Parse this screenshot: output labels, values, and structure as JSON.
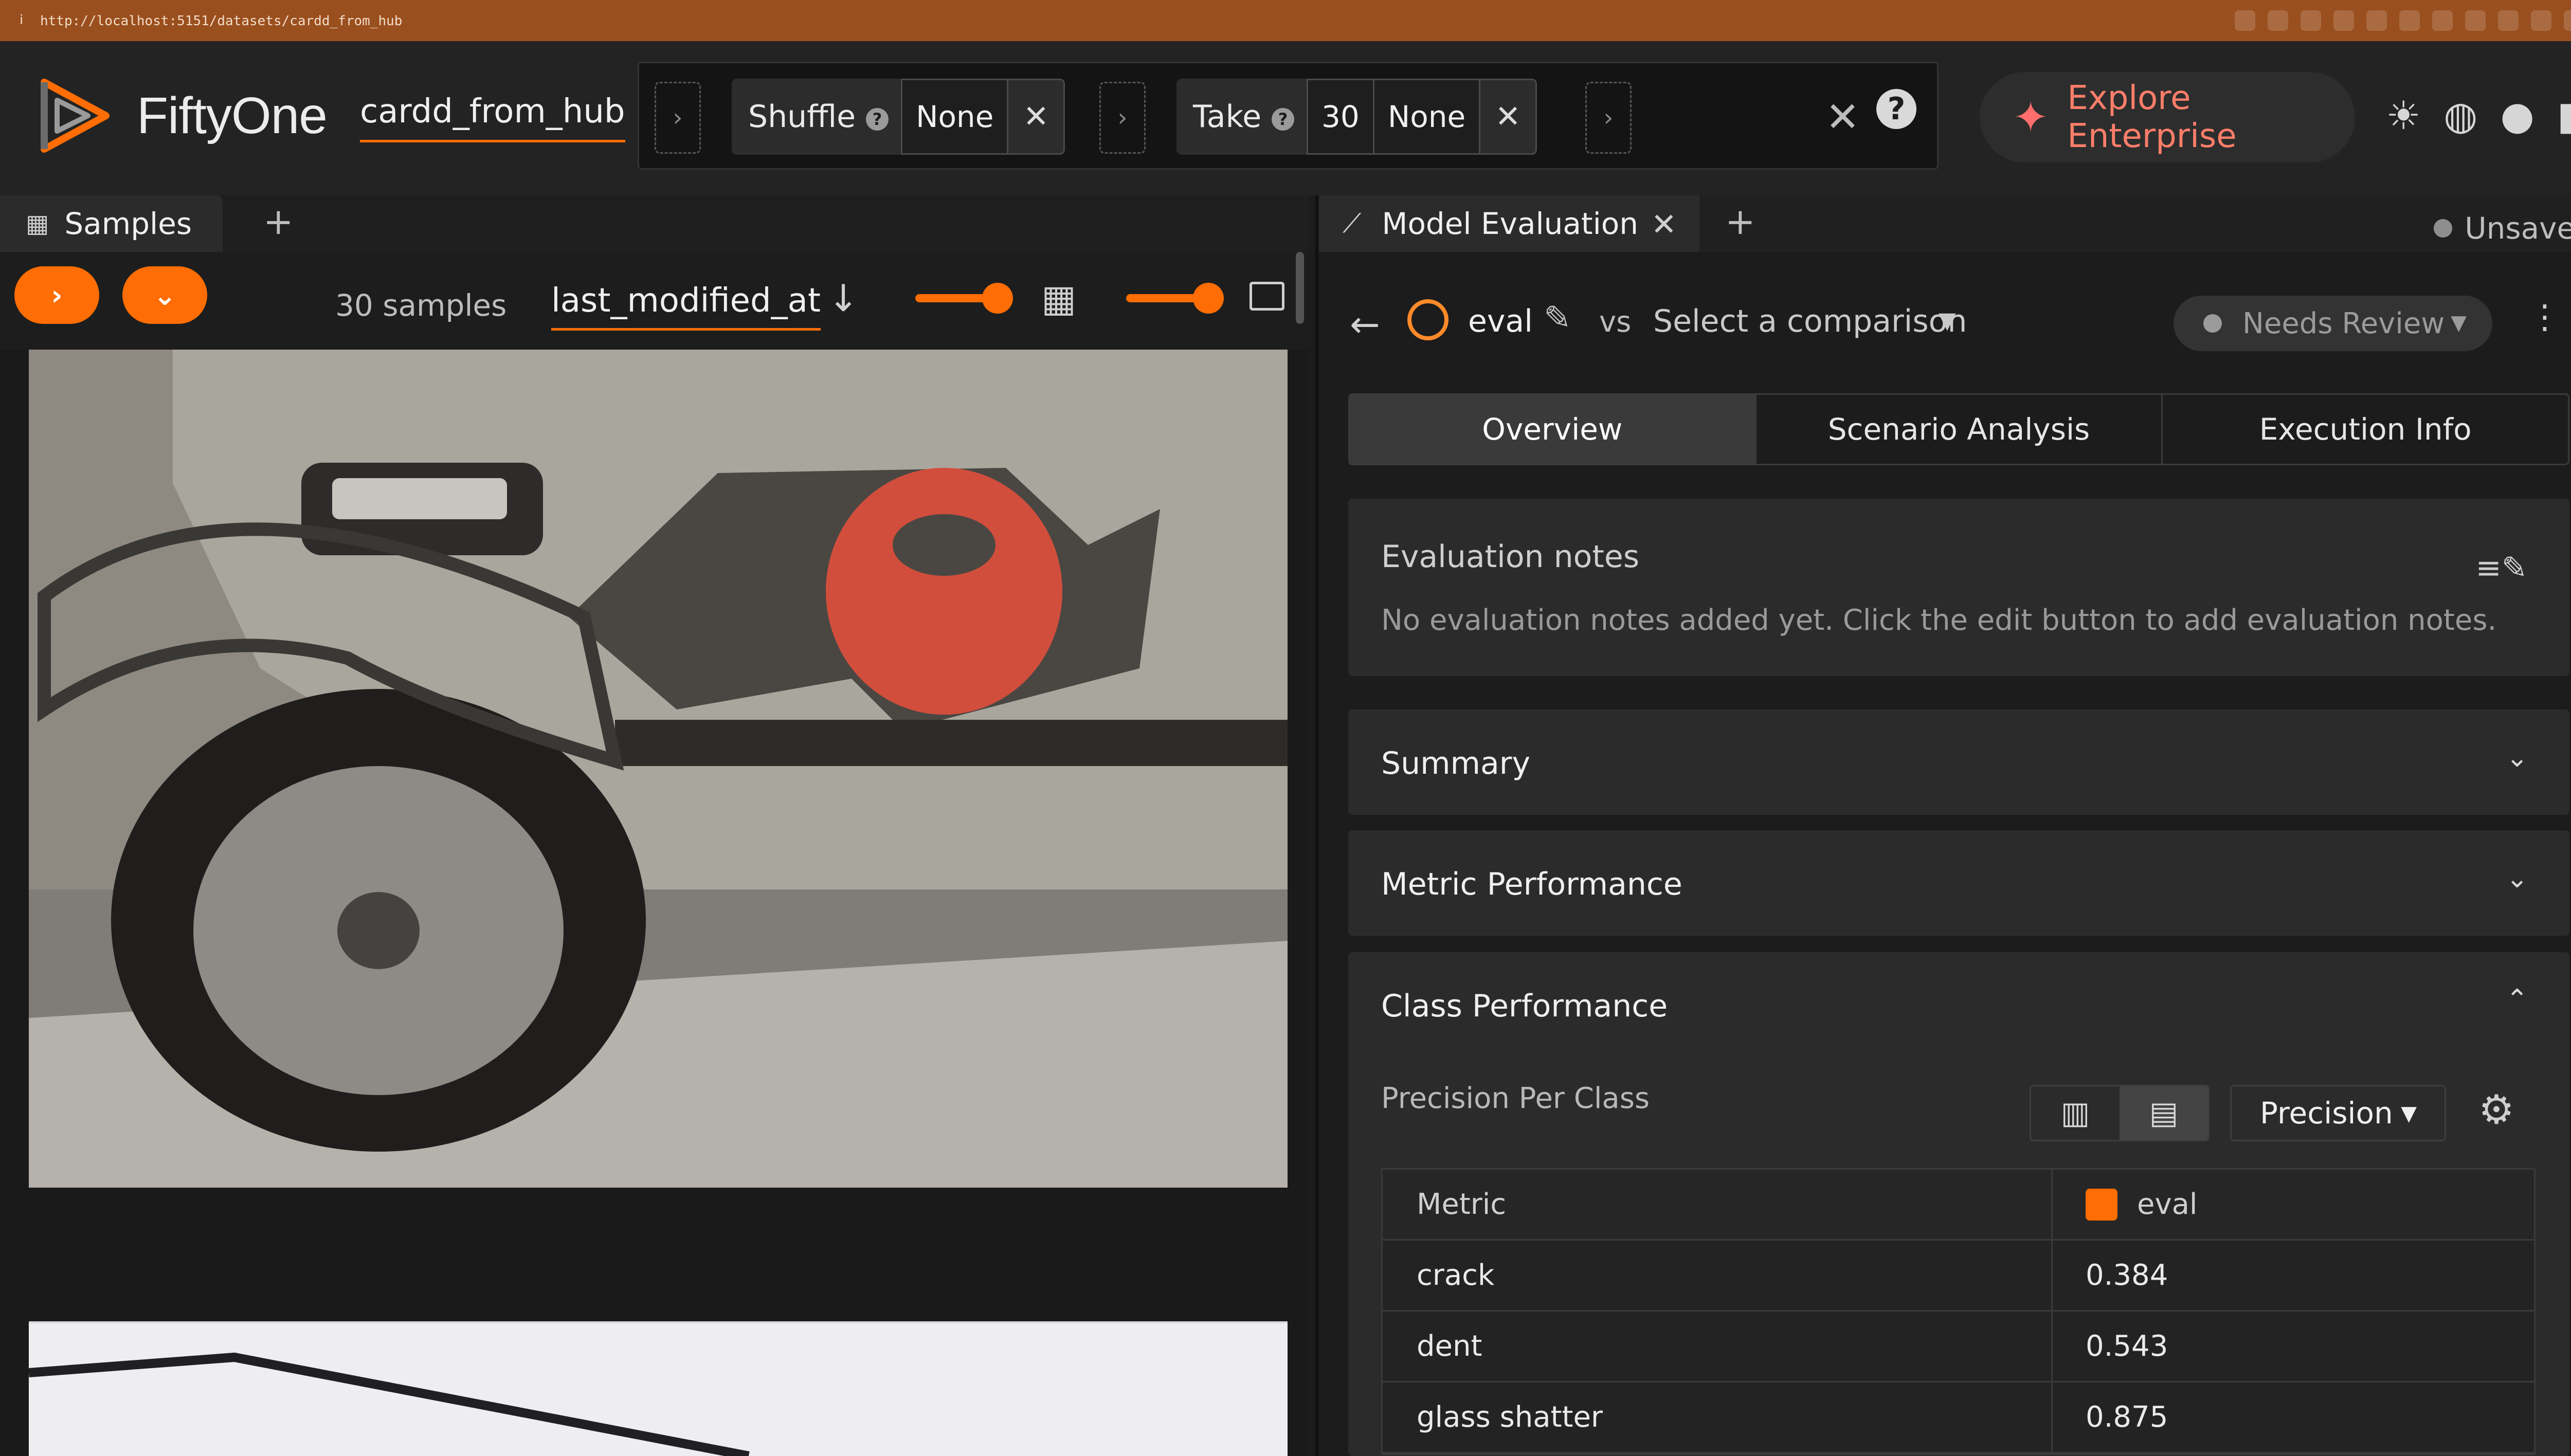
{
  "browser": {
    "url": "http://localhost:5151/datasets/cardd_from_hub",
    "info_icon": "info-icon"
  },
  "header": {
    "brand": "FiftyOne",
    "dataset_name": "cardd_from_hub",
    "stages": {
      "shuffle": {
        "label": "Shuffle",
        "value": "None"
      },
      "take": {
        "label": "Take",
        "count": "30",
        "value": "None"
      }
    },
    "enterprise_label": "Explore Enterprise",
    "icons": [
      "theme-toggle-icon",
      "discord-icon",
      "github-icon",
      "docs-icon"
    ]
  },
  "samples": {
    "tab_label": "Samples",
    "count_label": "30 samples",
    "sort_field": "last_modified_at"
  },
  "evaluation": {
    "panel_title": "Model Evaluation",
    "saved_state": "Unsaved",
    "eval_name": "eval",
    "vs_label": "vs",
    "compare_placeholder": "Select a comparison",
    "status": "Needs Review",
    "tabs": [
      "Overview",
      "Scenario Analysis",
      "Execution Info"
    ],
    "active_tab": "Overview",
    "notes": {
      "title": "Evaluation notes",
      "text": "No evaluation notes added yet. Click the edit button to add evaluation notes."
    },
    "sections": {
      "summary": "Summary",
      "metric_performance": "Metric Performance",
      "class_performance": "Class Performance"
    },
    "class_performance": {
      "subtitle": "Precision Per Class",
      "metric_select": "Precision",
      "columns": [
        "Metric",
        "eval"
      ],
      "series_color": "#ff6d04",
      "rows": [
        {
          "metric": "crack",
          "eval": "0.384"
        },
        {
          "metric": "dent",
          "eval": "0.543"
        },
        {
          "metric": "glass shatter",
          "eval": "0.875"
        }
      ]
    }
  },
  "colors": {
    "accent": "#ff6d04",
    "background": "#1c1c1c",
    "browser_bar": "#9a4f1e"
  }
}
